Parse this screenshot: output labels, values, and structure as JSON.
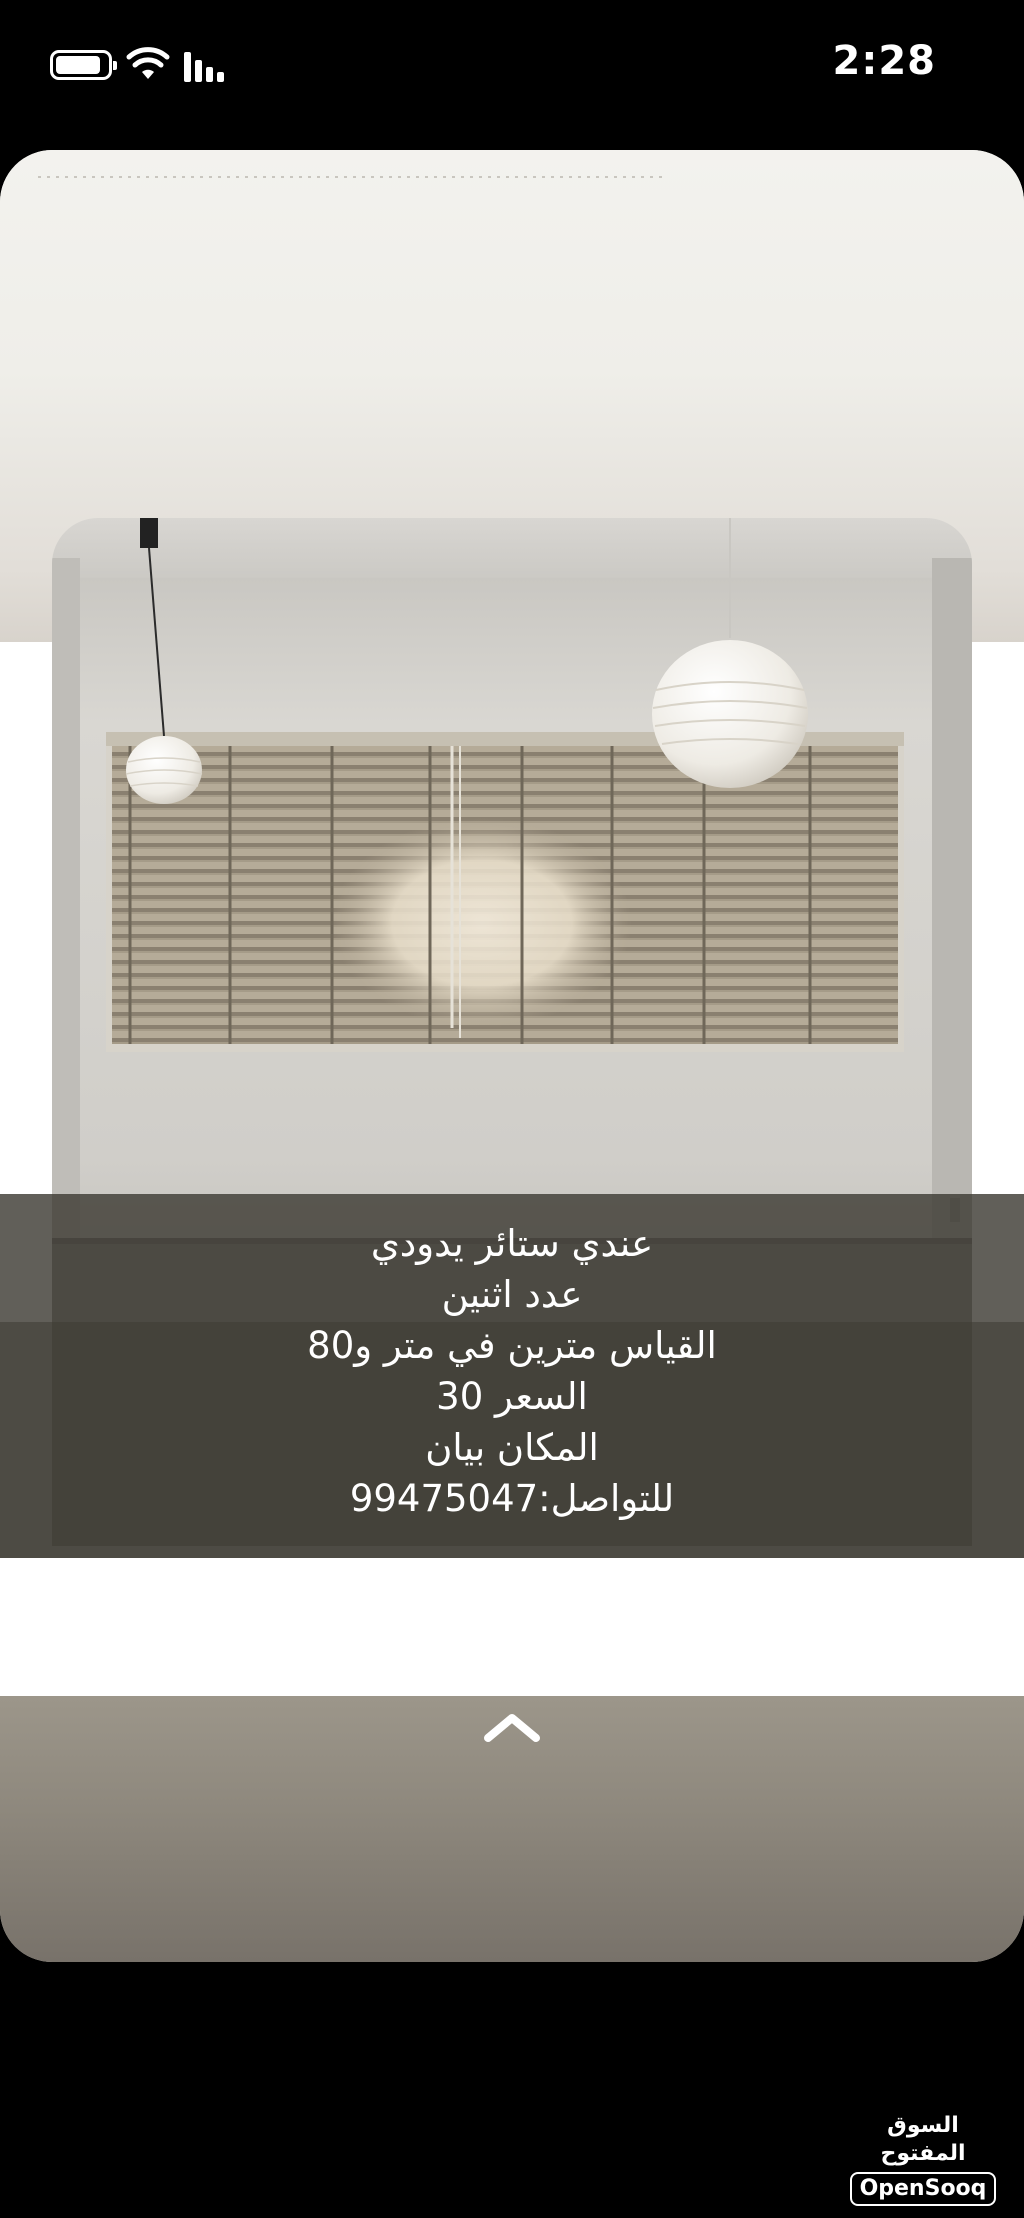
{
  "status_bar": {
    "time": "2:28",
    "battery_icon": "battery-icon",
    "wifi_icon": "wifi-icon",
    "signal_icon": "cellular-signal-icon"
  },
  "post": {
    "photo_subject": "room-window-blinds-photo",
    "caption_lines": [
      "عندي ستائر يدودي",
      "عدد اثنين",
      "القياس مترين في متر و80",
      "السعر 30",
      "المكان بيان",
      "للتواصل:99475047"
    ],
    "expand_icon": "chevron-up-icon"
  },
  "watermark": {
    "arabic": "السوق المفتوح",
    "latin": "OpenSooq"
  }
}
